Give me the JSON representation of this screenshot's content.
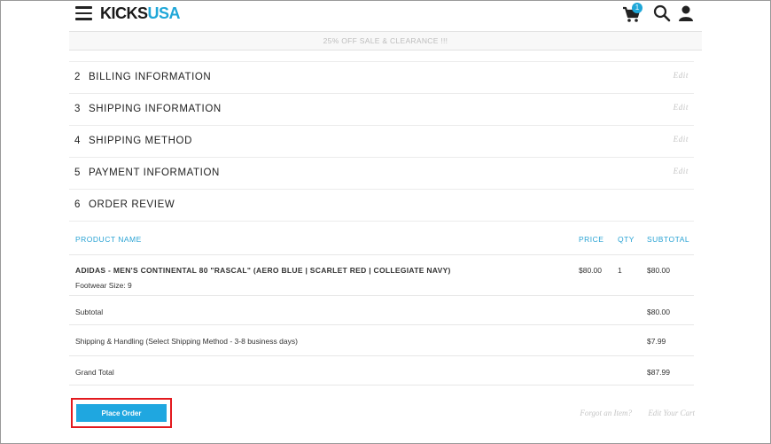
{
  "header": {
    "logo_part1": "KICKS",
    "logo_part2": "USA",
    "cart_count": "1",
    "colors": {
      "brand": "#1fa7d8",
      "accent_button": "#1fa7e0",
      "highlight_border": "#e3191e"
    },
    "icons": [
      "menu-icon",
      "cart-icon",
      "search-icon",
      "user-icon"
    ]
  },
  "promo": {
    "text": "25% OFF SALE & CLEARANCE !!!"
  },
  "steps": [
    {
      "num": "2",
      "label": "BILLING INFORMATION",
      "edit": "Edit"
    },
    {
      "num": "3",
      "label": "SHIPPING INFORMATION",
      "edit": "Edit"
    },
    {
      "num": "4",
      "label": "SHIPPING METHOD",
      "edit": "Edit"
    },
    {
      "num": "5",
      "label": "PAYMENT INFORMATION",
      "edit": "Edit"
    },
    {
      "num": "6",
      "label": "ORDER REVIEW",
      "edit": ""
    }
  ],
  "review": {
    "headers": {
      "product": "PRODUCT NAME",
      "price": "PRICE",
      "qty": "QTY",
      "subtotal": "SUBTOTAL"
    },
    "item": {
      "name": "ADIDAS - MEN'S CONTINENTAL 80 \"RASCAL\" (AERO BLUE | SCARLET RED | COLLEGIATE NAVY)",
      "option": "Footwear Size: 9",
      "price": "$80.00",
      "qty": "1",
      "subtotal": "$80.00"
    },
    "totals": [
      {
        "label": "Subtotal",
        "value": "$80.00"
      },
      {
        "label": "Shipping & Handling (Select Shipping Method - 3-8 business days)",
        "value": "$7.99"
      },
      {
        "label": "Grand Total",
        "value": "$87.99"
      }
    ]
  },
  "actions": {
    "place_order": "Place Order",
    "forgot_item": "Forgot an Item?",
    "edit_cart": "Edit Your Cart"
  }
}
